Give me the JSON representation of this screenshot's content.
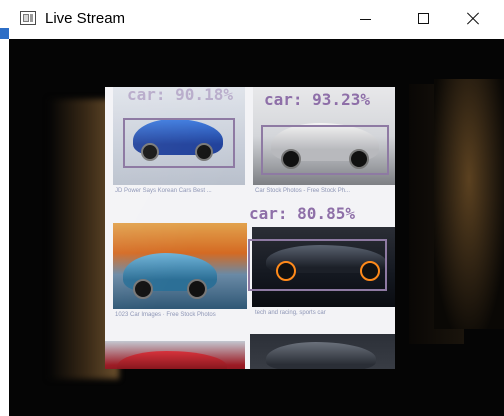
{
  "window": {
    "title": "Live Stream",
    "controls": {
      "minimize": "minimize-icon",
      "maximize": "maximize-icon",
      "close": "close-icon"
    }
  },
  "colors": {
    "detection": "#8e7aa3",
    "accent_blue": "#2d6ec6"
  },
  "detections": [
    {
      "label": "car: 90.18%"
    },
    {
      "label": "car: 93.23%"
    },
    {
      "label": "car: 80.85%"
    }
  ],
  "thumbnails": [
    {
      "caption": "JD Power Says Korean Cars Best ..."
    },
    {
      "caption": "Car Stock Photos - Free Stock Ph..."
    },
    {
      "caption": "1023 Car Images · Free Stock Photos"
    },
    {
      "caption": "tech and racing, sports car"
    },
    {
      "caption": ""
    },
    {
      "caption": ""
    }
  ]
}
